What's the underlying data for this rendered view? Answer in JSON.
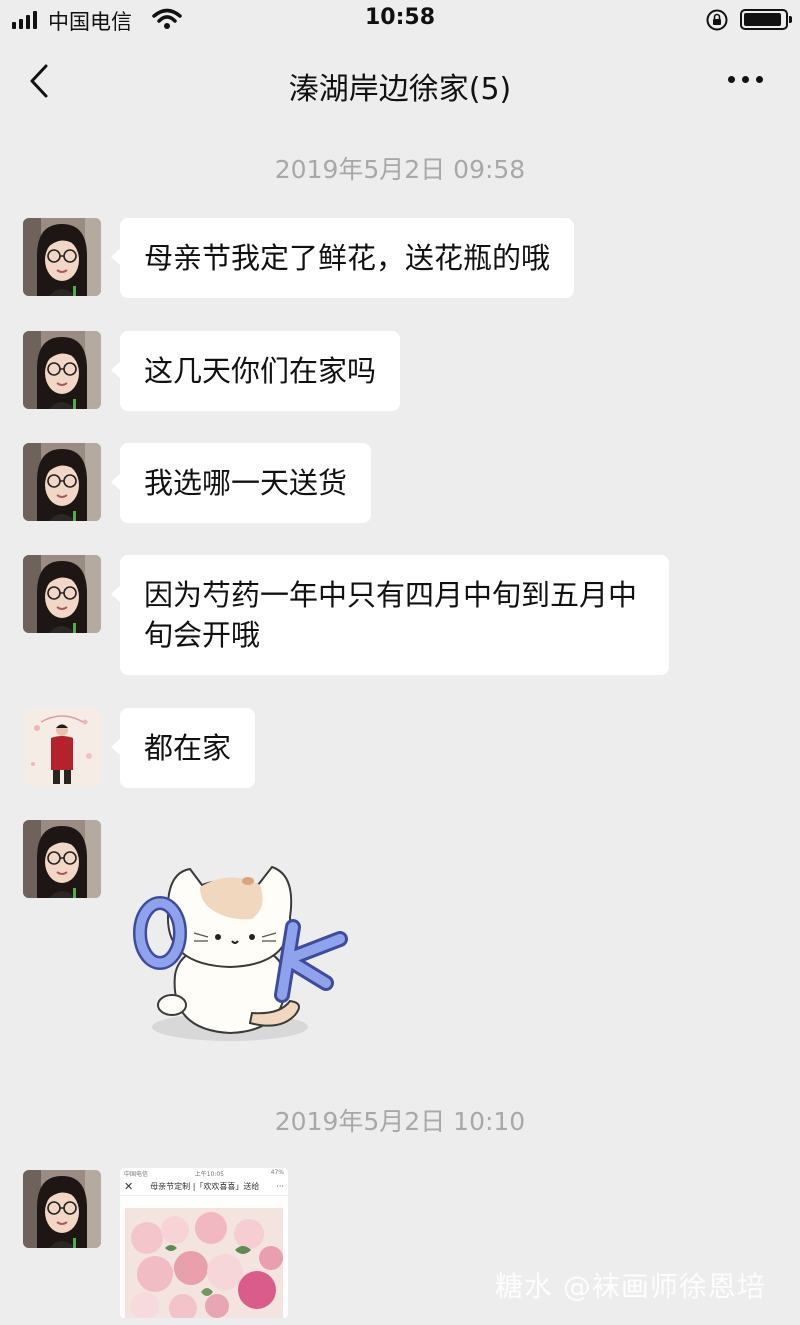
{
  "status_bar": {
    "carrier": "中国电信",
    "time": "10:58"
  },
  "nav": {
    "title": "溱湖岸边徐家(5)"
  },
  "timestamps": [
    "2019年5月2日 09:58",
    "2019年5月2日 10:10"
  ],
  "messages": [
    {
      "text": "母亲节我定了鲜花，送花瓶的哦"
    },
    {
      "text": "这几天你们在家吗"
    },
    {
      "text": "我选哪一天送货"
    },
    {
      "text": "因为芍药一年中只有四月中旬到五月中旬会开哦"
    },
    {
      "text": "都在家"
    }
  ],
  "link_card": {
    "carrier": "中国电信",
    "time": "上午10:05",
    "battery": "47%",
    "title": "母亲节定制 |「欢欢喜喜」送给"
  },
  "watermark": "糖水 @袜画师徐恩培"
}
